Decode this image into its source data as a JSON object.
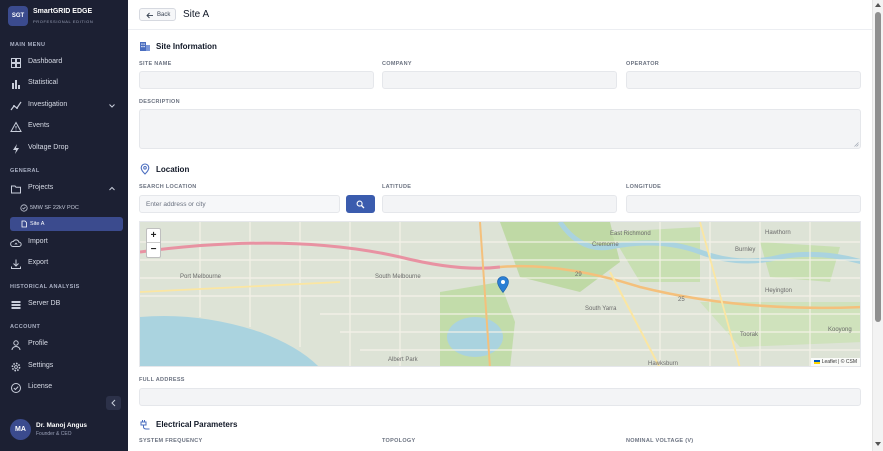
{
  "app": {
    "logo_text": "SGT",
    "name": "SmartGRID EDGE",
    "edition": "PROFESSIONAL EDITION"
  },
  "sidebar": {
    "sections": {
      "main": "MAIN MENU",
      "general": "GENERAL",
      "historical": "HISTORICAL ANALYSIS",
      "account": "ACCOUNT"
    },
    "items": {
      "dashboard": {
        "label": "Dashboard",
        "icon": "dashboard-icon"
      },
      "statistical": {
        "label": "Statistical",
        "icon": "bar-chart-icon"
      },
      "investigation": {
        "label": "Investigation",
        "icon": "investigation-icon"
      },
      "events": {
        "label": "Events",
        "icon": "warning-icon"
      },
      "voltage_drop": {
        "label": "Voltage Drop",
        "icon": "lightning-icon"
      },
      "projects": {
        "label": "Projects",
        "icon": "folder-icon"
      },
      "project_sub": {
        "label": "5MW SF 22kV POC",
        "icon": "check-circle-icon"
      },
      "site_sub": {
        "label": "Site A",
        "icon": "file-icon"
      },
      "import": {
        "label": "Import",
        "icon": "cloud-upload-icon"
      },
      "export": {
        "label": "Export",
        "icon": "download-icon"
      },
      "server_db": {
        "label": "Server DB",
        "icon": "database-icon"
      },
      "profile": {
        "label": "Profile",
        "icon": "user-icon"
      },
      "settings": {
        "label": "Settings",
        "icon": "gear-icon"
      },
      "license": {
        "label": "License",
        "icon": "badge-check-icon"
      }
    }
  },
  "user": {
    "initials": "MA",
    "name": "Dr. Manoj Angus",
    "role": "Founder & CEO"
  },
  "header": {
    "back_label": "Back",
    "title": "Site A"
  },
  "site_info": {
    "heading": "Site Information",
    "site_name_label": "SITE NAME",
    "company_label": "COMPANY",
    "operator_label": "OPERATOR",
    "description_label": "DESCRIPTION"
  },
  "location": {
    "heading": "Location",
    "search_label": "SEARCH LOCATION",
    "search_placeholder": "Enter address or city",
    "latitude_label": "LATITUDE",
    "longitude_label": "LONGITUDE",
    "full_address_label": "FULL ADDRESS"
  },
  "map": {
    "zoom_in": "+",
    "zoom_out": "−",
    "attribution": "Leaflet | © CSM",
    "labels": {
      "port_melbourne": "Port Melbourne",
      "south_melbourne": "South Melbourne",
      "east_richmond": "East Richmond",
      "cremorne": "Cremorne",
      "burnley": "Burnley",
      "hawthorn": "Hawthorn",
      "south_yarra": "South Yarra",
      "toorak": "Toorak",
      "albert_park": "Albert Park",
      "heyington": "Heyington",
      "kooyong": "Kooyong",
      "hawksburn": "Hawksburn",
      "road_25": "25",
      "road_29": "29"
    }
  },
  "electrical": {
    "heading": "Electrical Parameters",
    "frequency_label": "SYSTEM FREQUENCY",
    "topology_label": "TOPOLOGY",
    "voltage_label": "NOMINAL VOLTAGE (V)"
  },
  "colors": {
    "sidebar_bg": "#1c2033",
    "accent": "#3b4b8e",
    "search_button": "#3b5cae"
  }
}
